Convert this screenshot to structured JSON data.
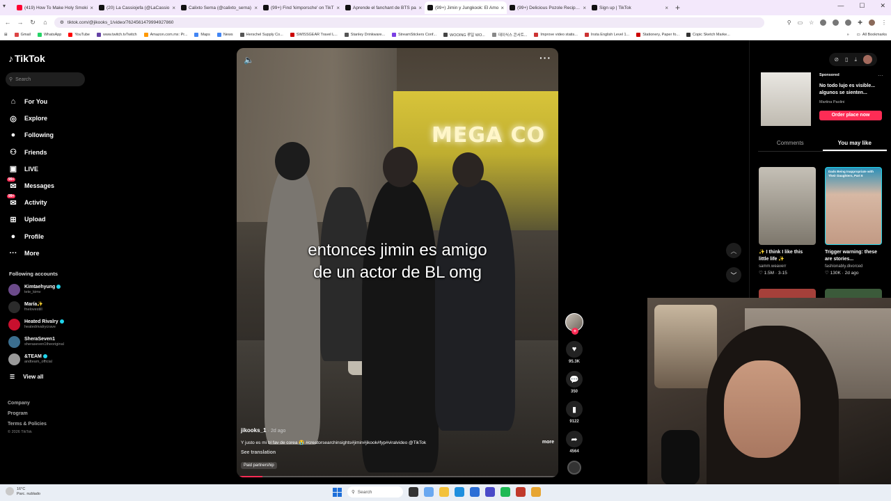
{
  "browser": {
    "tabs": [
      {
        "title": "(419) How To Make Holy Smoki",
        "color": "#ff0033"
      },
      {
        "title": "(20) La Cassiojefa (@LaCassio",
        "color": "#111111"
      },
      {
        "title": "Calixto Serna (@calixto_serna)",
        "color": "#111111"
      },
      {
        "title": "(99+) Find 'kimporsche' on TikT",
        "color": "#111111"
      },
      {
        "title": "Aprende el fanchant de BTS pa",
        "color": "#111111"
      },
      {
        "title": "(99+) Jimin y Jungkook: El Amo",
        "color": "#111111"
      },
      {
        "title": "(99+) Delicious Pozole Recipe fo",
        "color": "#111111"
      },
      {
        "title": "Sign up | TikTok",
        "color": "#111111"
      }
    ],
    "active_tab": 5,
    "url": "tiktok.com/@jikooks_1/video/7624561479994927860",
    "bookmarks": [
      "Gmail",
      "WhatsApp",
      "YouTube",
      "www.twitch.tvTwitch",
      "Amazon.com.mx: Pr...",
      "Maps",
      "News",
      "Herschel Supply Co...",
      "SWISSGEAR Travel L...",
      "Stanley Drinkware...",
      "StreamStickers Conf...",
      "WOOING 루일 WO...",
      "데이식스 콘서트...",
      "Improve video statis...",
      "Insta English Level 1...",
      "Stationery, Paper fo...",
      "Copic Sketch Marke..."
    ],
    "bookmarks_more": "»",
    "all_bookmarks": "All Bookmarks"
  },
  "sidebar": {
    "logo": "TikTok",
    "search_placeholder": "Search",
    "nav": [
      {
        "label": "For You",
        "icon": "home-icon",
        "glyph": "⌂"
      },
      {
        "label": "Explore",
        "icon": "compass-icon",
        "glyph": "◎"
      },
      {
        "label": "Following",
        "icon": "following-icon",
        "glyph": "●"
      },
      {
        "label": "Friends",
        "icon": "friends-icon",
        "glyph": "⚇"
      },
      {
        "label": "LIVE",
        "icon": "live-icon",
        "glyph": "▣"
      },
      {
        "label": "Messages",
        "icon": "messages-icon",
        "glyph": "✉",
        "badge": "99+"
      },
      {
        "label": "Activity",
        "icon": "activity-icon",
        "glyph": "✉",
        "badge": "99+"
      },
      {
        "label": "Upload",
        "icon": "upload-icon",
        "glyph": "⊞"
      },
      {
        "label": "Profile",
        "icon": "profile-icon",
        "glyph": "●"
      },
      {
        "label": "More",
        "icon": "more-icon",
        "glyph": "···"
      }
    ],
    "following_title": "Following accounts",
    "accounts": [
      {
        "name": "Kimtaehyung",
        "handle": "tete_kimv",
        "verified": true,
        "color": "#6b4a8a"
      },
      {
        "name": "María",
        "handle": "fnelovestill",
        "verified": false,
        "color": "#2b2b2b",
        "emoji": "✨"
      },
      {
        "name": "Heated Rivalry",
        "handle": "heatedrivalrycrave",
        "verified": true,
        "color": "#c8102e"
      },
      {
        "name": "SheraSeven1",
        "handle": "sheraseven1theoriginal",
        "verified": false,
        "color": "#3b6e8f"
      },
      {
        "name": "&TEAM",
        "handle": "andteam_official",
        "verified": true,
        "color": "#999999"
      }
    ],
    "view_all": "View all",
    "footer": [
      "Company",
      "Program",
      "Terms & Policies"
    ],
    "copyright": "© 2026 TikTok"
  },
  "video": {
    "overlay_text_line1": "entonces jimin es amigo",
    "overlay_text_line2": "de un actor de BL omg",
    "store_sign": "MEGA CO",
    "author": "jikooks_1",
    "ago": "· 2d ago",
    "description": "Y justo es mi bl fav de corea 😭 #creatorsearchinsights#jimin#jikook#fyp#viralvideo @TikTok",
    "more": "more",
    "see_translation": "See translation",
    "paid": "Paid partnership",
    "progress": 0.08
  },
  "rail": {
    "likes": "95.3K",
    "comments": "350",
    "saves": "9122",
    "shares": "4564"
  },
  "right_panel": {
    "ad": {
      "sponsored": "Sponsored",
      "title": "No todo lujo es visible... algunos se sienten...",
      "brand": "Martina Paolini",
      "cta": "Order place now"
    },
    "tabs": [
      "Comments",
      "You may like"
    ],
    "active_tab": 1,
    "recs": [
      {
        "title": "✨ I think I like this little life ✨",
        "author": "samm.weaverr",
        "stats": "♡ 1.5M · 3-15"
      },
      {
        "title": "Trigger warning: these are stories...",
        "author": "fashionably.divorced",
        "stats": "♡ 130K · 2d ago",
        "thumb_text": "Dads Being Inappropriate with Their Daughters, Part 6"
      }
    ]
  },
  "taskbar": {
    "temp": "16°C",
    "weather": "Parc. nublado",
    "search": "Search"
  },
  "colors": {
    "accent": "#fe2c55",
    "verified": "#20d5ec"
  }
}
